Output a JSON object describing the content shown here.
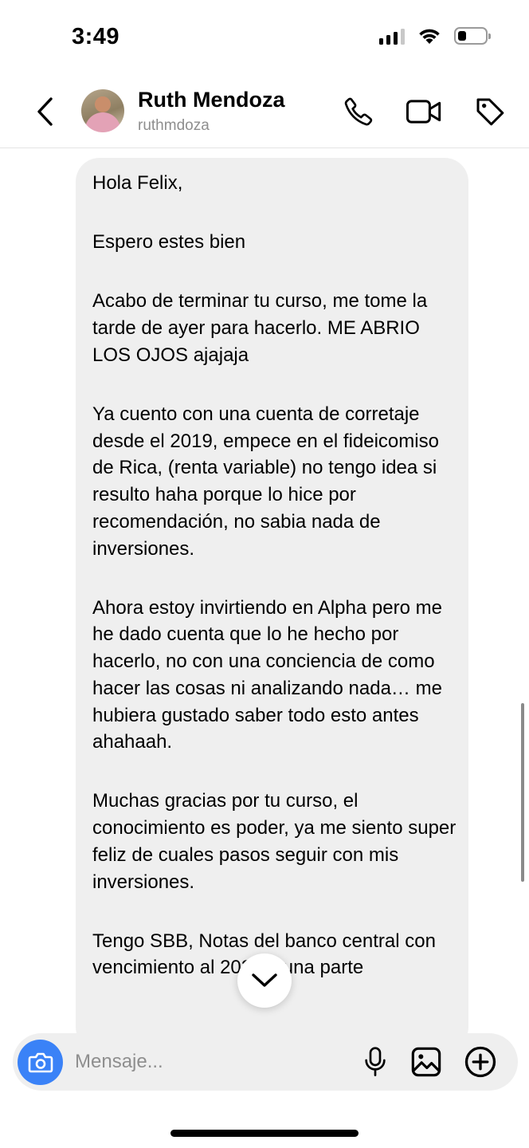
{
  "status_bar": {
    "time": "3:49",
    "icons": [
      "signal-icon",
      "wifi-icon",
      "battery-icon"
    ],
    "battery_level": 0.25
  },
  "header": {
    "back_icon": "chevron-left-icon",
    "contact_name": "Ruth Mendoza",
    "username": "ruthmdoza",
    "actions": [
      "phone-icon",
      "video-call-icon",
      "tag-icon"
    ]
  },
  "message": {
    "paragraphs": [
      "Hola Felix,",
      "Espero estes bien",
      "Acabo de terminar tu curso, me tome la tarde de ayer para hacerlo. ME ABRIO LOS OJOS ajajaja",
      "Ya cuento con una cuenta de corretaje desde el 2019, empece en el fideicomiso de Rica, (renta variable) no tengo idea si resulto haha porque lo hice por recomendación, no sabia nada de inversiones.",
      "Ahora estoy invirtiendo en Alpha pero me he dado cuenta que lo he hecho por hacerlo, no con una conciencia de como hacer las cosas ni analizando nada… me hubiera gustado saber todo esto antes ahahaah.",
      "Muchas gracias por tu curso, el conocimiento es poder, ya me siento super feliz de cuales pasos seguir con mis inversiones.",
      "Tengo SBB, Notas del banco central con vencimiento al 2025 y una parte"
    ]
  },
  "scroll_down_icon": "chevron-down-icon",
  "composer": {
    "placeholder": "Mensaje...",
    "camera_icon": "camera-icon",
    "actions": [
      "microphone-icon",
      "image-icon",
      "plus-circle-icon"
    ]
  },
  "colors": {
    "accent": "#3a82f7",
    "bubble": "#efefef",
    "secondary_text": "#8e8e8e"
  }
}
